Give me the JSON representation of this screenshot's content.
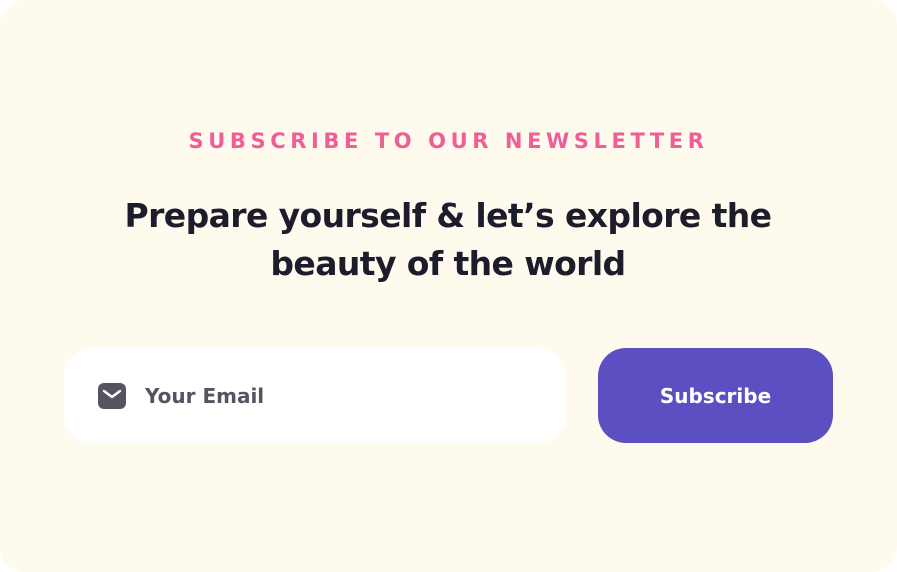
{
  "newsletter": {
    "eyebrow": "SUBSCRIBE TO OUR NEWSLETTER",
    "headline": "Prepare yourself & let’s explore the beauty of the world",
    "email_placeholder": "Your Email",
    "email_value": "",
    "email_icon": "mail-icon",
    "subscribe_label": "Subscribe"
  },
  "colors": {
    "background": "#fffaee",
    "eyebrow": "#ef5e97",
    "headline": "#1d1c2b",
    "input_background": "#ffffff",
    "input_text": "#555461",
    "button_background": "#5b4fc2",
    "button_text": "#ffffff"
  }
}
